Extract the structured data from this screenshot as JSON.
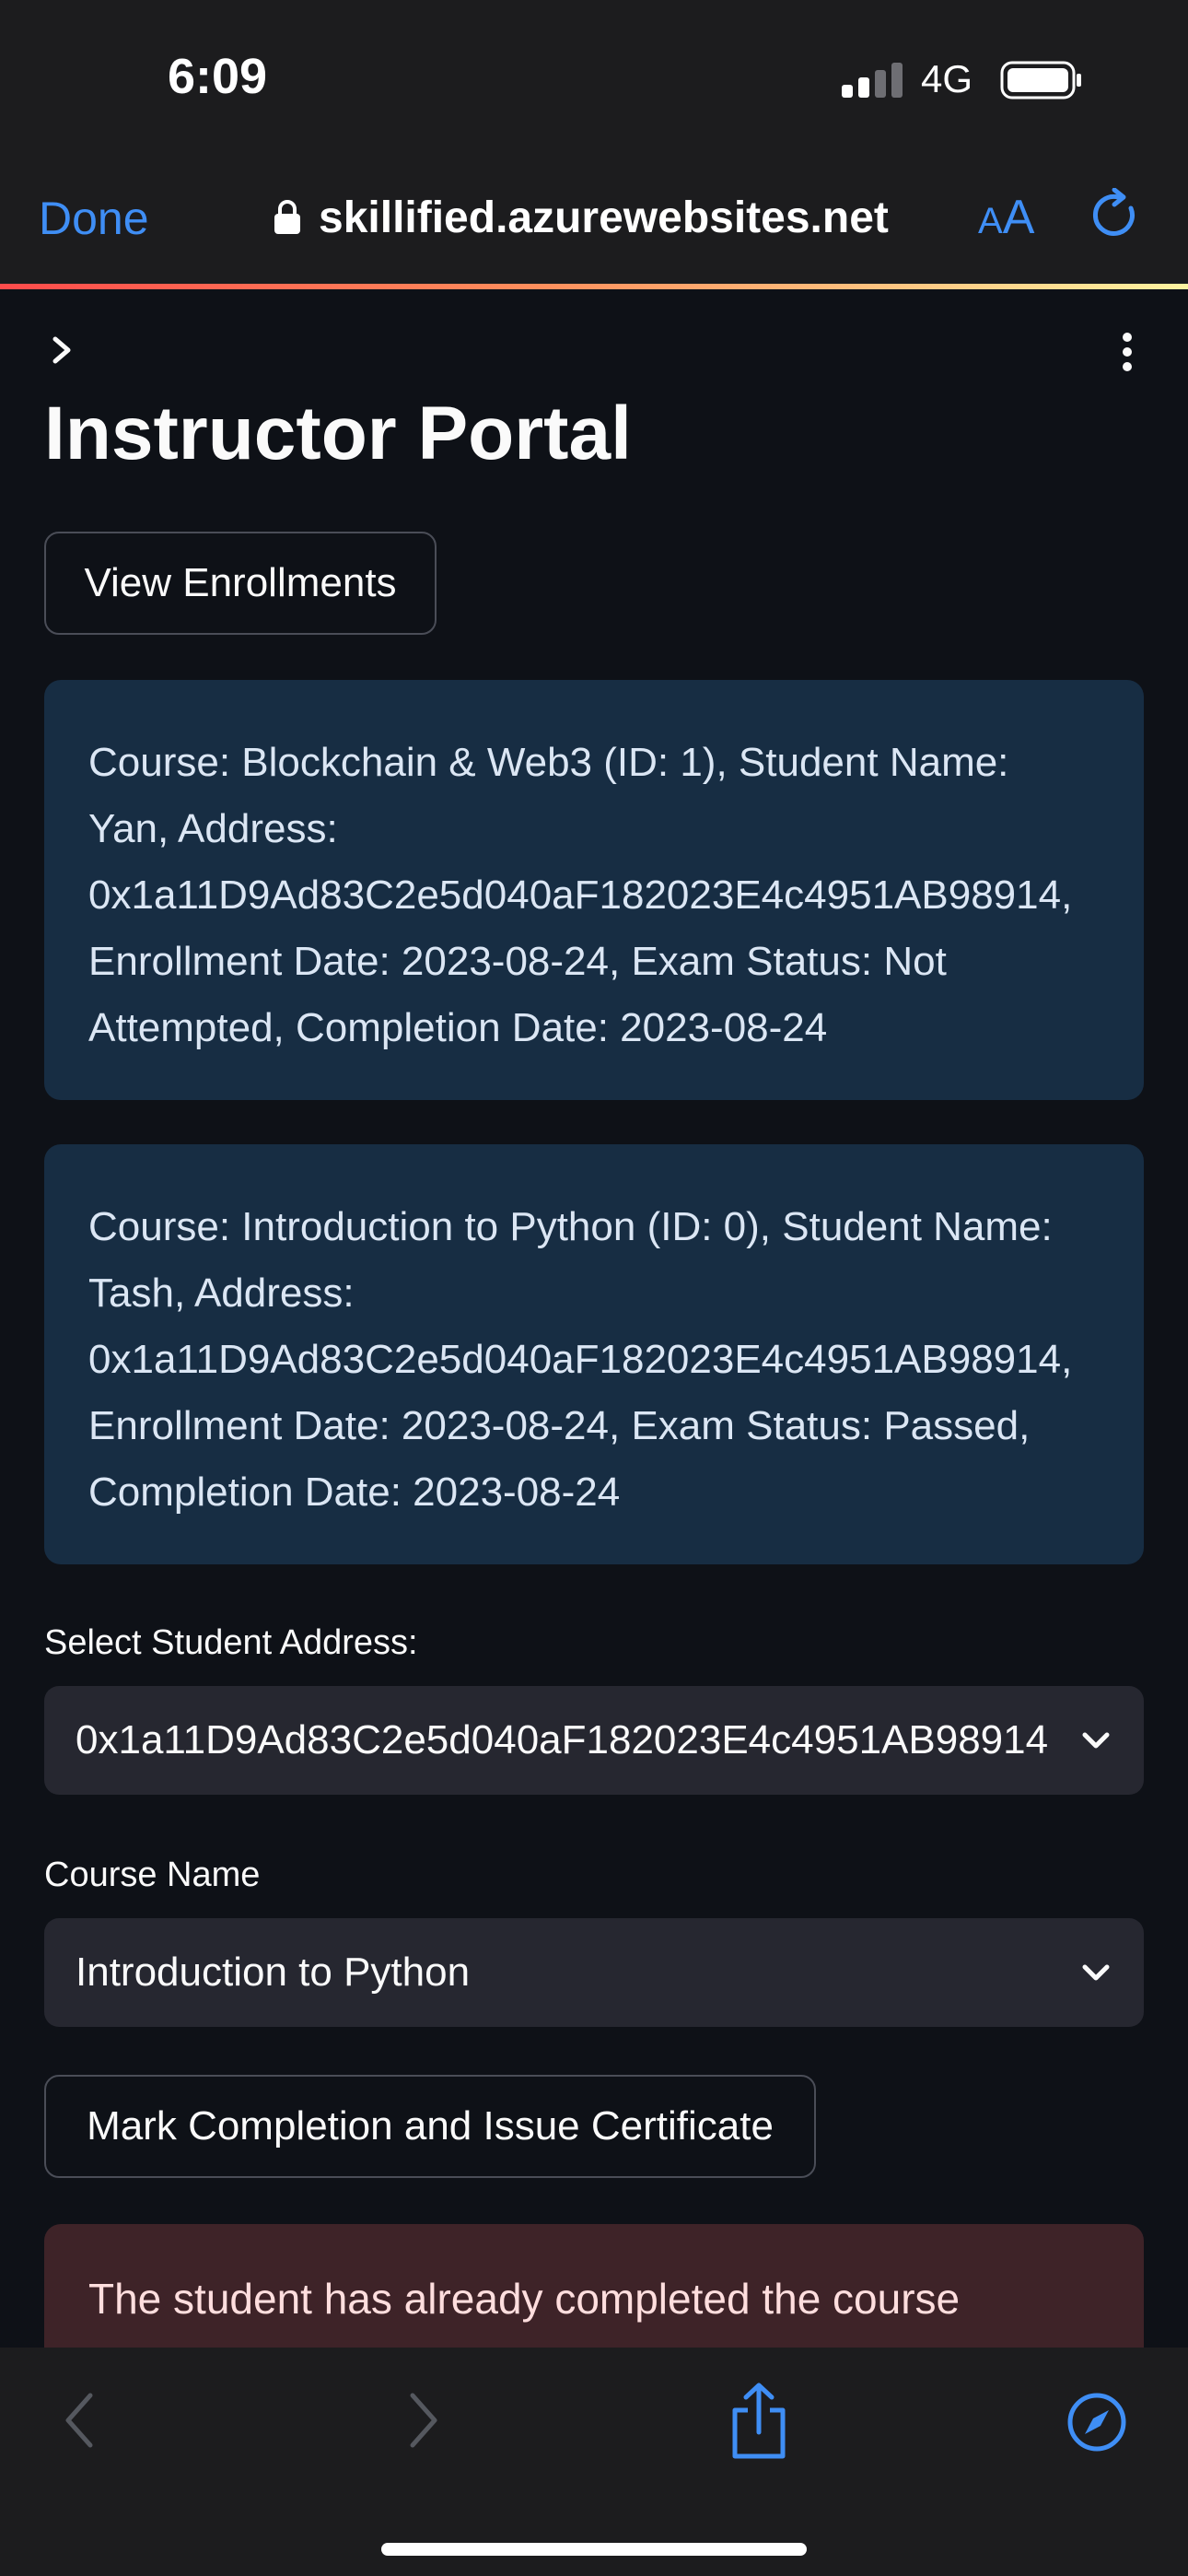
{
  "status_bar": {
    "time": "6:09",
    "network": "4G"
  },
  "browser": {
    "done_label": "Done",
    "url": "skillified.azurewebsites.net",
    "text_size_small": "A",
    "text_size_large": "A"
  },
  "page": {
    "title": "Instructor Portal",
    "view_enrollments_label": "View Enrollments",
    "enrollments": [
      "Course: Blockchain & Web3 (ID: 1), Student Name: Yan, Address: 0x1a11D9Ad83C2e5d040aF182023E4c4951AB98914, Enrollment Date: 2023-08-24, Exam Status: Not Attempted, Completion Date: 2023-08-24",
      "Course: Introduction to Python (ID: 0), Student Name: Tash, Address: 0x1a11D9Ad83C2e5d040aF182023E4c4951AB98914, Enrollment Date: 2023-08-24, Exam Status: Passed, Completion Date: 2023-08-24"
    ],
    "student_address_label": "Select Student Address:",
    "student_address_value": "0x1a11D9Ad83C2e5d040aF182023E4c4951AB98914",
    "course_name_label": "Course Name",
    "course_name_value": "Introduction to Python",
    "mark_completion_label": "Mark Completion and Issue Certificate",
    "error_message": "The student has already completed the course"
  },
  "colors": {
    "accent_blue": "#3f8ef5",
    "page_bg": "#0e1117",
    "info_card_bg": "#172d43",
    "error_bg": "#3e2328",
    "select_bg": "#262730"
  }
}
